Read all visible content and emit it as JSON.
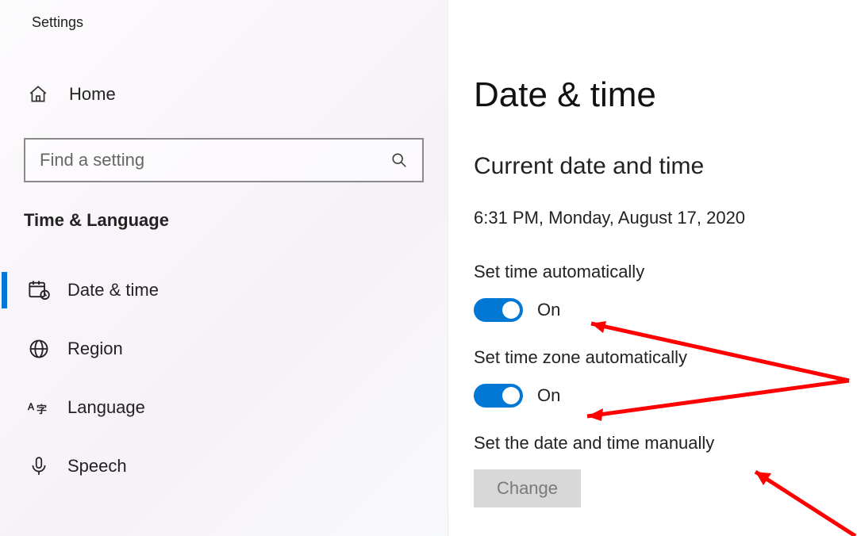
{
  "window_title": "Settings",
  "sidebar": {
    "home_label": "Home",
    "search_placeholder": "Find a setting",
    "category_label": "Time & Language",
    "items": [
      {
        "label": "Date & time",
        "icon": "calendar-clock",
        "active": true
      },
      {
        "label": "Region",
        "icon": "globe",
        "active": false
      },
      {
        "label": "Language",
        "icon": "language",
        "active": false
      },
      {
        "label": "Speech",
        "icon": "microphone",
        "active": false
      }
    ]
  },
  "main": {
    "page_title": "Date & time",
    "section_title": "Current date and time",
    "current_datetime": "6:31 PM, Monday, August 17, 2020",
    "auto_time_label": "Set time automatically",
    "auto_time_state": "On",
    "auto_tz_label": "Set time zone automatically",
    "auto_tz_state": "On",
    "manual_label": "Set the date and time manually",
    "change_button": "Change"
  },
  "colors": {
    "accent": "#0078d4",
    "arrow": "#ff0000"
  }
}
